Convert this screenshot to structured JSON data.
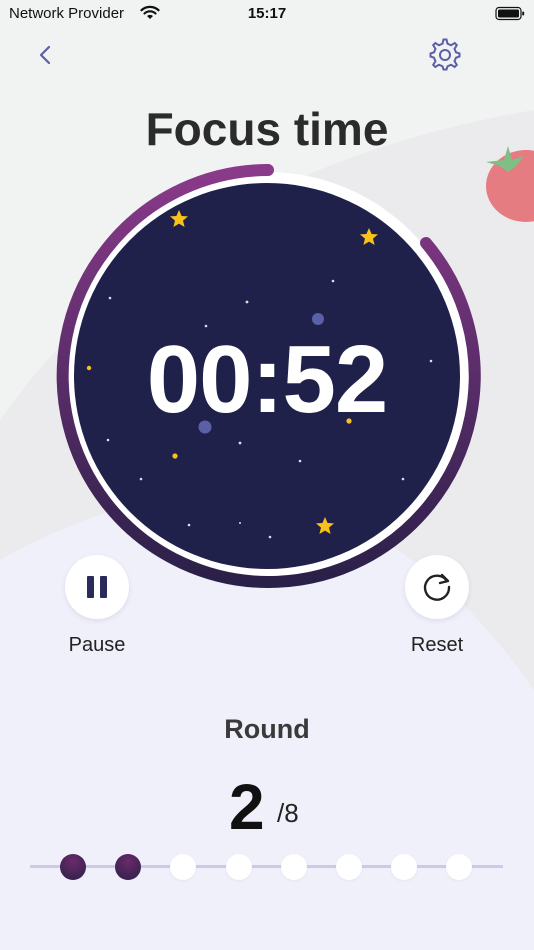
{
  "status_bar": {
    "carrier": "Network Provider",
    "time": "15:17"
  },
  "header": {
    "title": "Focus time"
  },
  "timer": {
    "display": "00:52"
  },
  "controls": {
    "pause_label": "Pause",
    "reset_label": "Reset"
  },
  "round": {
    "label": "Round",
    "current": "2",
    "total": "/8",
    "completed": 2,
    "count": 8
  },
  "colors": {
    "dial_bg": "#20214a",
    "ring_purple": "#8a3a8a",
    "star": "#f8c21a",
    "accent": "#5a5fa8"
  },
  "icons": [
    "wifi-icon",
    "battery-icon",
    "back-chevron-icon",
    "settings-gear-icon",
    "tomato-icon",
    "pause-icon",
    "reset-icon",
    "star-icon"
  ]
}
